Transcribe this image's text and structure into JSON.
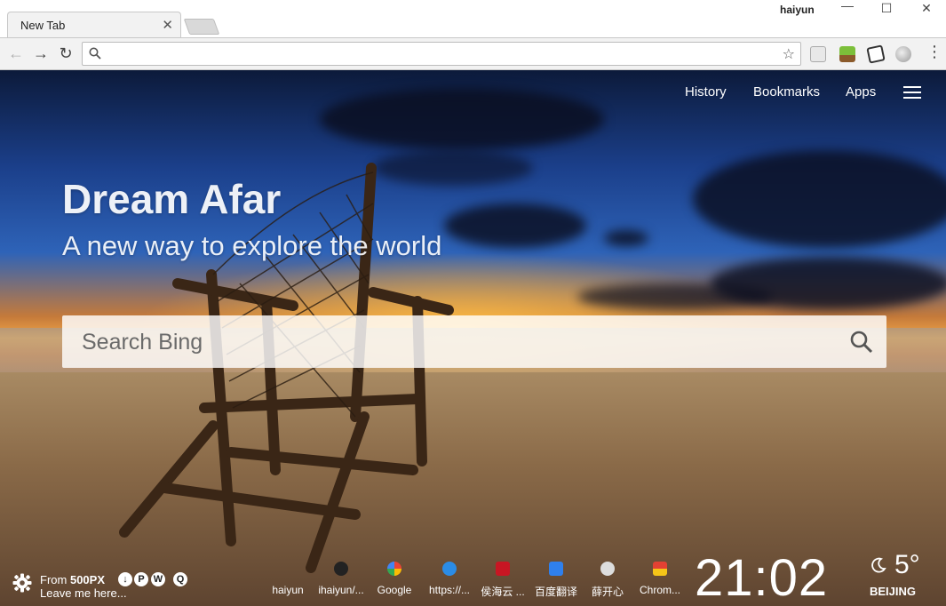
{
  "browser": {
    "tab_title": "New Tab",
    "tab_close": "✕",
    "profile_name": "haiyun",
    "window_min": "—",
    "window_max": "☐",
    "window_close": "✕",
    "nav_back": "←",
    "nav_forward": "→",
    "nav_reload": "↻",
    "address_value": "",
    "bookmark_star": "☆",
    "menu": "⋮"
  },
  "topnav": {
    "history": "History",
    "bookmarks": "Bookmarks",
    "apps": "Apps"
  },
  "hero": {
    "title": "Dream Afar",
    "subtitle": "A new way to explore the world"
  },
  "search": {
    "placeholder": "Search Bing"
  },
  "credits": {
    "from": "From",
    "source": "500PX",
    "note": "Leave me here..."
  },
  "dock": [
    {
      "label": "haiyun",
      "icon": "haiyun-icon",
      "color": "transparent"
    },
    {
      "label": "ihaiyun/...",
      "icon": "github-icon",
      "color": "#222222"
    },
    {
      "label": "Google",
      "icon": "google-icon",
      "color": "#ffffff"
    },
    {
      "label": "https://...",
      "icon": "smile-icon",
      "color": "#2b8ce6"
    },
    {
      "label": "侯海云 ...",
      "icon": "csdn-icon",
      "color": "#c81623"
    },
    {
      "label": "百度翻译",
      "icon": "translate-icon",
      "color": "#2f80ed"
    },
    {
      "label": "薛开心",
      "icon": "rabbit-icon",
      "color": "#dddddd"
    },
    {
      "label": "Chrom...",
      "icon": "chrome-icon",
      "color": "#e0e0e0"
    }
  ],
  "clock": {
    "time": "21:02"
  },
  "weather": {
    "temp": "5°",
    "city": "BEIJING",
    "icon": "moon-icon"
  }
}
